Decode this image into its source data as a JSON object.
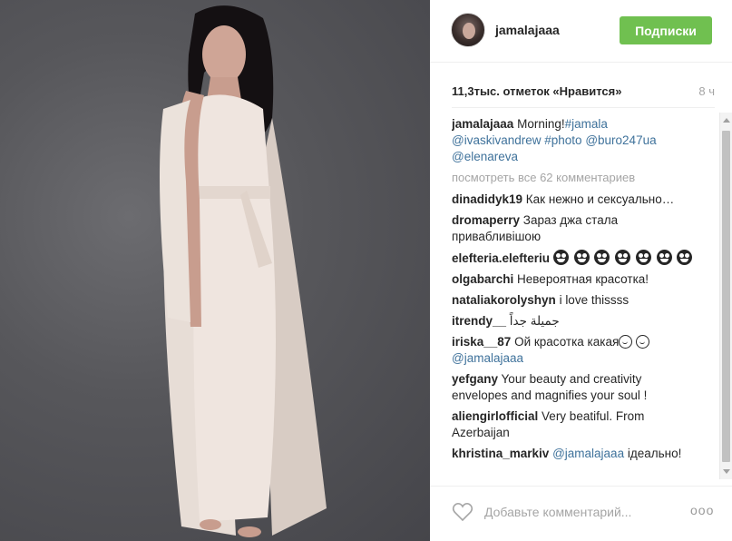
{
  "header": {
    "username": "jamalajaaa",
    "follow_label": "Подписки"
  },
  "stats": {
    "likes": "11,3тыс. отметок «Нравится»",
    "time": "8 ч"
  },
  "caption": {
    "user": "jamalajaaa",
    "text": "Morning!",
    "tags": [
      "#jamala",
      "@ivaskivandrew",
      "#photo",
      "@buro247ua",
      "@elenareva"
    ]
  },
  "view_all": "посмотреть все 62 комментариев",
  "comments": [
    {
      "user": "dinadidyk19",
      "text": "Как нежно и сексуально…"
    },
    {
      "user": "dromaperry",
      "text": "Зараз джа стала привабливішою"
    },
    {
      "user": "elefteria.elefteriu",
      "text": ""
    },
    {
      "user": "olgabarchi",
      "text": "Невероятная красотка!"
    },
    {
      "user": "nataliakorolyshyn",
      "text": "i love thissss"
    },
    {
      "user": "itrendy__",
      "text": "جميلة جداً"
    },
    {
      "user": "iriska__87",
      "text": "Ой красотка какая",
      "mention": "@jamalajaaa"
    },
    {
      "user": "yefgany",
      "text": "Your beauty and creativity envelopes and magnifies your soul !"
    },
    {
      "user": "aliengirlofficial",
      "text": "Very beatiful. From Azerbaijan"
    },
    {
      "user": "khristina_markiv",
      "mention": "@jamalajaaa",
      "text": "ідеально!"
    }
  ],
  "footer": {
    "comment_placeholder": "Добавьте комментарий...",
    "more": "ooo"
  }
}
